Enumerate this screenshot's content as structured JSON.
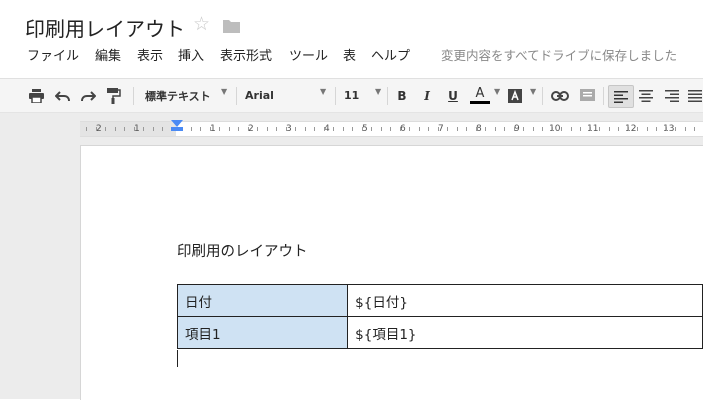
{
  "title": "印刷用レイアウト",
  "menu": [
    "ファイル",
    "編集",
    "表示",
    "挿入",
    "表示形式",
    "ツール",
    "表",
    "ヘルプ"
  ],
  "save_status": "変更内容をすべてドライブに保存しました",
  "toolbar": {
    "style_select": "標準テキスト",
    "font_select": "Arial",
    "size_select": "11",
    "bold": "B",
    "italic": "I",
    "underline": "U",
    "text_color": "A"
  },
  "ruler": {
    "left_numbers": [
      "2",
      "1"
    ],
    "right_numbers": [
      "1",
      "2",
      "3",
      "4",
      "5",
      "6",
      "7",
      "8",
      "9",
      "10",
      "11",
      "12",
      "13"
    ]
  },
  "document": {
    "heading": "印刷用のレイアウト",
    "table": [
      [
        "日付",
        "${日付}"
      ],
      [
        "項目1",
        "${項目1}"
      ]
    ]
  },
  "colors": {
    "table_label_bg": "#cfe2f3",
    "indent_marker": "#4a8af4"
  },
  "icons": [
    "star-icon",
    "folder-icon",
    "print-icon",
    "undo-icon",
    "redo-icon",
    "paint-format-icon",
    "highlight-icon",
    "link-icon",
    "comment-icon",
    "align-left-icon",
    "align-center-icon",
    "align-right-icon",
    "align-justify-icon"
  ]
}
